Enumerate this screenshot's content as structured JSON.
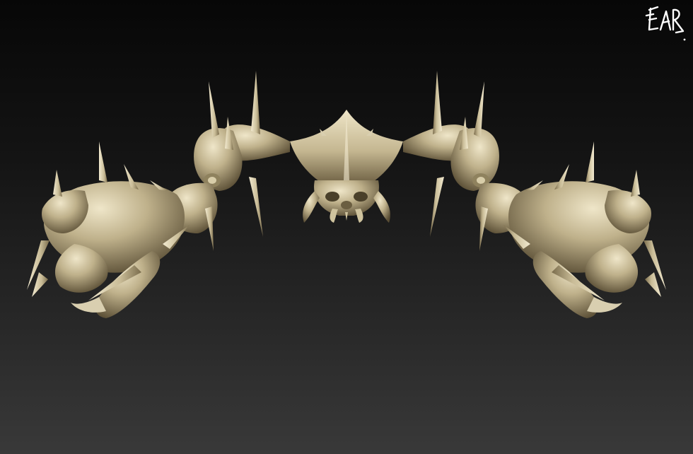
{
  "scene": {
    "subject": "crab-creature-sculpt-render",
    "colors": {
      "background_top": "#070707",
      "background_bottom": "#393939",
      "material_highlight": "#ece3c6",
      "material_mid": "#b9ab85",
      "material_shadow": "#5e5238",
      "spike": "#d9cfb0"
    }
  },
  "signature": {
    "text": "EAR",
    "color": "#ffffff"
  }
}
